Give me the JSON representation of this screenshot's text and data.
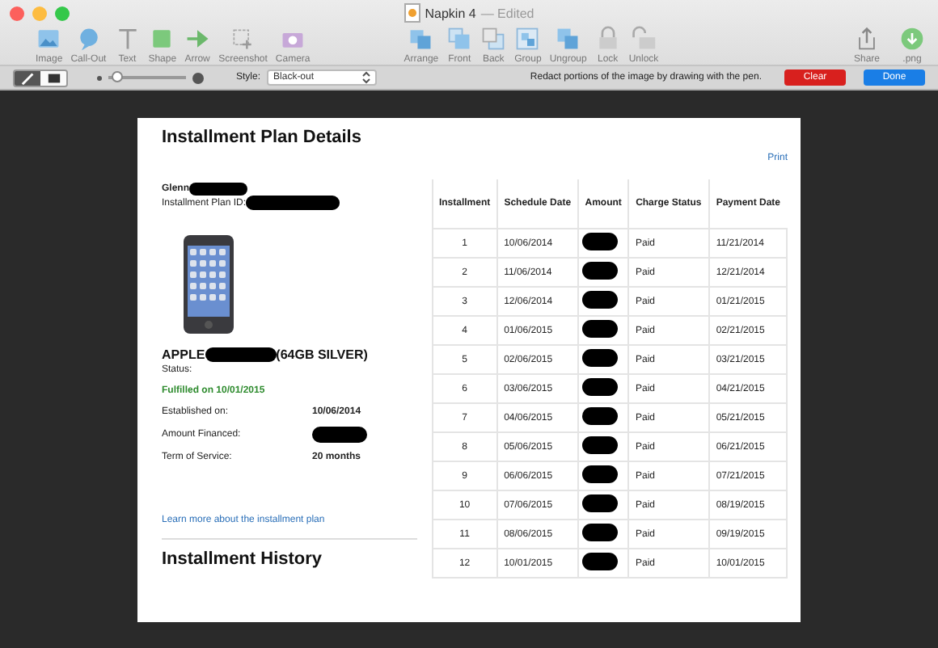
{
  "window": {
    "title": "Napkin 4",
    "subtitle": "— Edited"
  },
  "toolbar": {
    "left": [
      {
        "label": "Image"
      },
      {
        "label": "Call-Out"
      },
      {
        "label": "Text"
      },
      {
        "label": "Shape"
      },
      {
        "label": "Arrow"
      },
      {
        "label": "Screenshot"
      },
      {
        "label": "Camera"
      }
    ],
    "middle": [
      {
        "label": "Arrange"
      },
      {
        "label": "Front"
      },
      {
        "label": "Back"
      },
      {
        "label": "Group"
      },
      {
        "label": "Ungroup"
      },
      {
        "label": "Lock"
      },
      {
        "label": "Unlock"
      }
    ],
    "right": [
      {
        "label": "Share"
      },
      {
        "label": ".png"
      }
    ]
  },
  "pen_bar": {
    "tools": [
      {
        "kind": "pen",
        "selected": true
      },
      {
        "kind": "stamp",
        "selected": false
      }
    ],
    "size": {
      "level": 0.12
    },
    "style_label": "Style:",
    "style_value": "Black-out",
    "hint": "Redact portions of the image by drawing with the pen.",
    "clear": "Clear",
    "done": "Done"
  },
  "document": {
    "title": "Installment Plan Details",
    "print": "Print",
    "name": "Glenn",
    "plan_id_label": "Installment Plan ID:",
    "product_prefix": "APPLE",
    "product_suffix": "(64GB SILVER)",
    "status_label": "Status:",
    "status_value": "Fulfilled on 10/01/2015",
    "fields": [
      {
        "label": "Established on:",
        "value": "10/06/2014"
      },
      {
        "label": "Amount Financed:"
      },
      {
        "label": "Term of Service:",
        "value": "20 months"
      }
    ],
    "link": "Learn more about the installment plan",
    "history_title": "Installment History",
    "table": {
      "columns": [
        "Installment",
        "Schedule Date",
        "Amount",
        "Charge Status",
        "Payment Date"
      ],
      "rows": [
        [
          "1",
          "10/06/2014",
          null,
          "Paid",
          "11/21/2014"
        ],
        [
          "2",
          "11/06/2014",
          null,
          "Paid",
          "12/21/2014"
        ],
        [
          "3",
          "12/06/2014",
          null,
          "Paid",
          "01/21/2015"
        ],
        [
          "4",
          "01/06/2015",
          null,
          "Paid",
          "02/21/2015"
        ],
        [
          "5",
          "02/06/2015",
          null,
          "Paid",
          "03/21/2015"
        ],
        [
          "6",
          "03/06/2015",
          null,
          "Paid",
          "04/21/2015"
        ],
        [
          "7",
          "04/06/2015",
          null,
          "Paid",
          "05/21/2015"
        ],
        [
          "8",
          "05/06/2015",
          null,
          "Paid",
          "06/21/2015"
        ],
        [
          "9",
          "06/06/2015",
          null,
          "Paid",
          "07/21/2015"
        ],
        [
          "10",
          "07/06/2015",
          null,
          "Paid",
          "08/19/2015"
        ],
        [
          "11",
          "08/06/2015",
          null,
          "Paid",
          "09/19/2015"
        ],
        [
          "12",
          "10/01/2015",
          null,
          "Paid",
          "10/01/2015"
        ]
      ]
    }
  }
}
